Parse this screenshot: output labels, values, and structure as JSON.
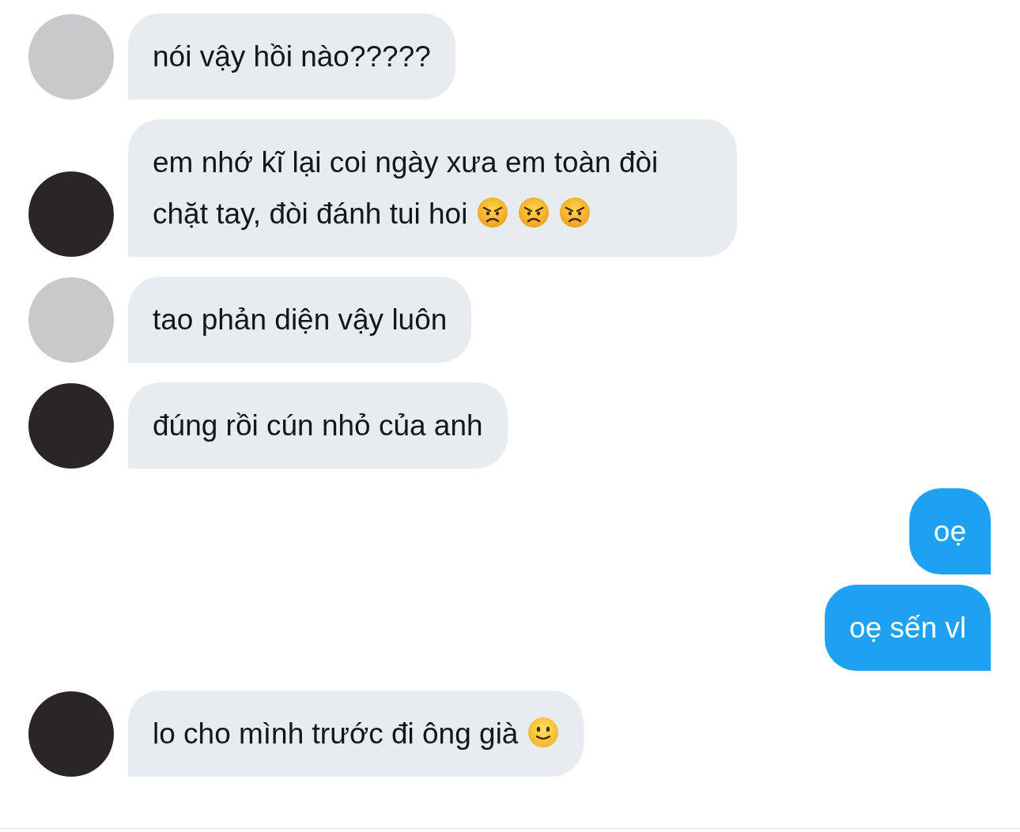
{
  "messages": [
    {
      "kind": "incoming",
      "avatar": {
        "kind": "light"
      },
      "text": "nói vậy hồi nào?????"
    },
    {
      "kind": "incoming",
      "avatar": {
        "kind": "dark"
      },
      "text": "em nhớ kĩ lại coi ngày xưa em toàn đòi chặt tay, đòi đánh tui hoi",
      "emojis": [
        {
          "kind": "angry"
        },
        {
          "kind": "angry"
        },
        {
          "kind": "angry"
        }
      ]
    },
    {
      "kind": "incoming",
      "avatar": {
        "kind": "light"
      },
      "text": "tao phản diện vậy luôn"
    },
    {
      "kind": "incoming",
      "avatar": {
        "kind": "dark"
      },
      "text": "đúng rồi cún nhỏ của anh"
    },
    {
      "kind": "outgoing",
      "text": "oẹ"
    },
    {
      "kind": "outgoing",
      "text": "oẹ sến vl"
    },
    {
      "kind": "incoming",
      "avatar": {
        "kind": "dark"
      },
      "text": "lo cho mình trước đi ông già",
      "emojis": [
        {
          "kind": "smile"
        }
      ]
    }
  ]
}
